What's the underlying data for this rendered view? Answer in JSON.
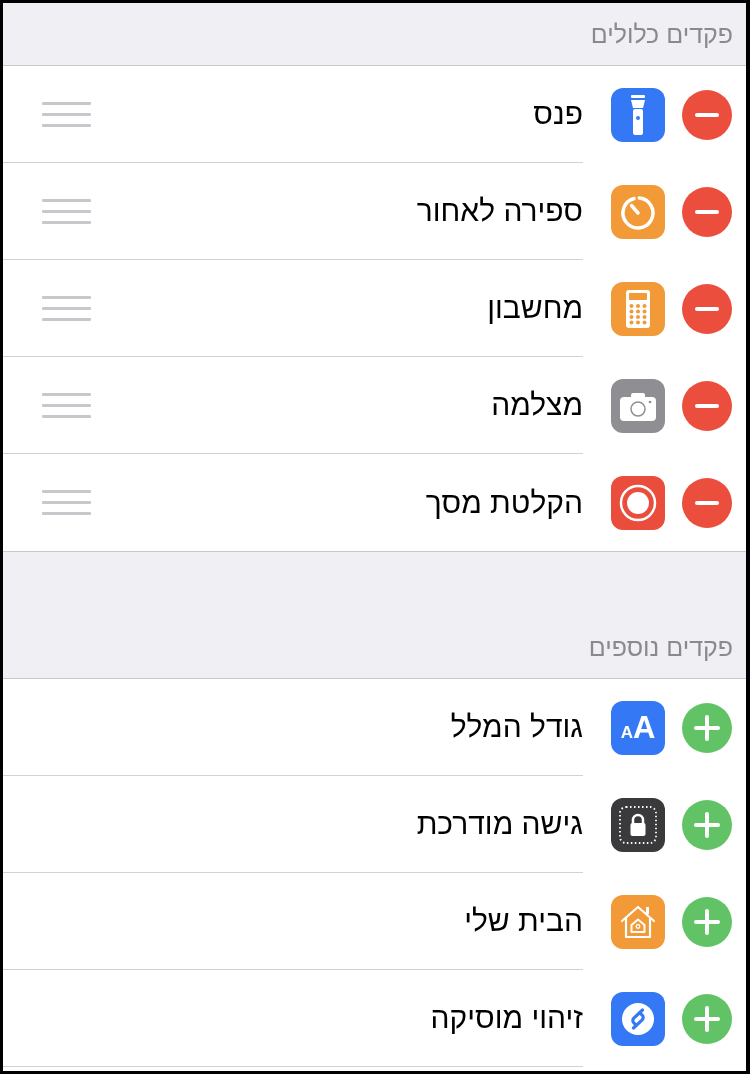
{
  "sections": [
    {
      "kind": "included",
      "header": "פקדים כלולים",
      "items": [
        {
          "label": "פנס",
          "color": "#3478f6"
        },
        {
          "label": "ספירה לאחור",
          "color": "#f19a37"
        },
        {
          "label": "מחשבון",
          "color": "#f19a37"
        },
        {
          "label": "מצלמה",
          "color": "#8e8e93"
        },
        {
          "label": "הקלטת מסך",
          "color": "#eb4d3d"
        }
      ]
    },
    {
      "kind": "more",
      "header": "פקדים נוספים",
      "items": [
        {
          "label": "גודל המלל",
          "color": "#3478f6",
          "icon_text": "AA"
        },
        {
          "label": "גישה מודרכת",
          "color": "#3a3a3c"
        },
        {
          "label": "הבית שלי",
          "color": "#f19a37"
        },
        {
          "label": "זיהוי מוסיקה",
          "color": "#3478f6"
        }
      ]
    }
  ]
}
